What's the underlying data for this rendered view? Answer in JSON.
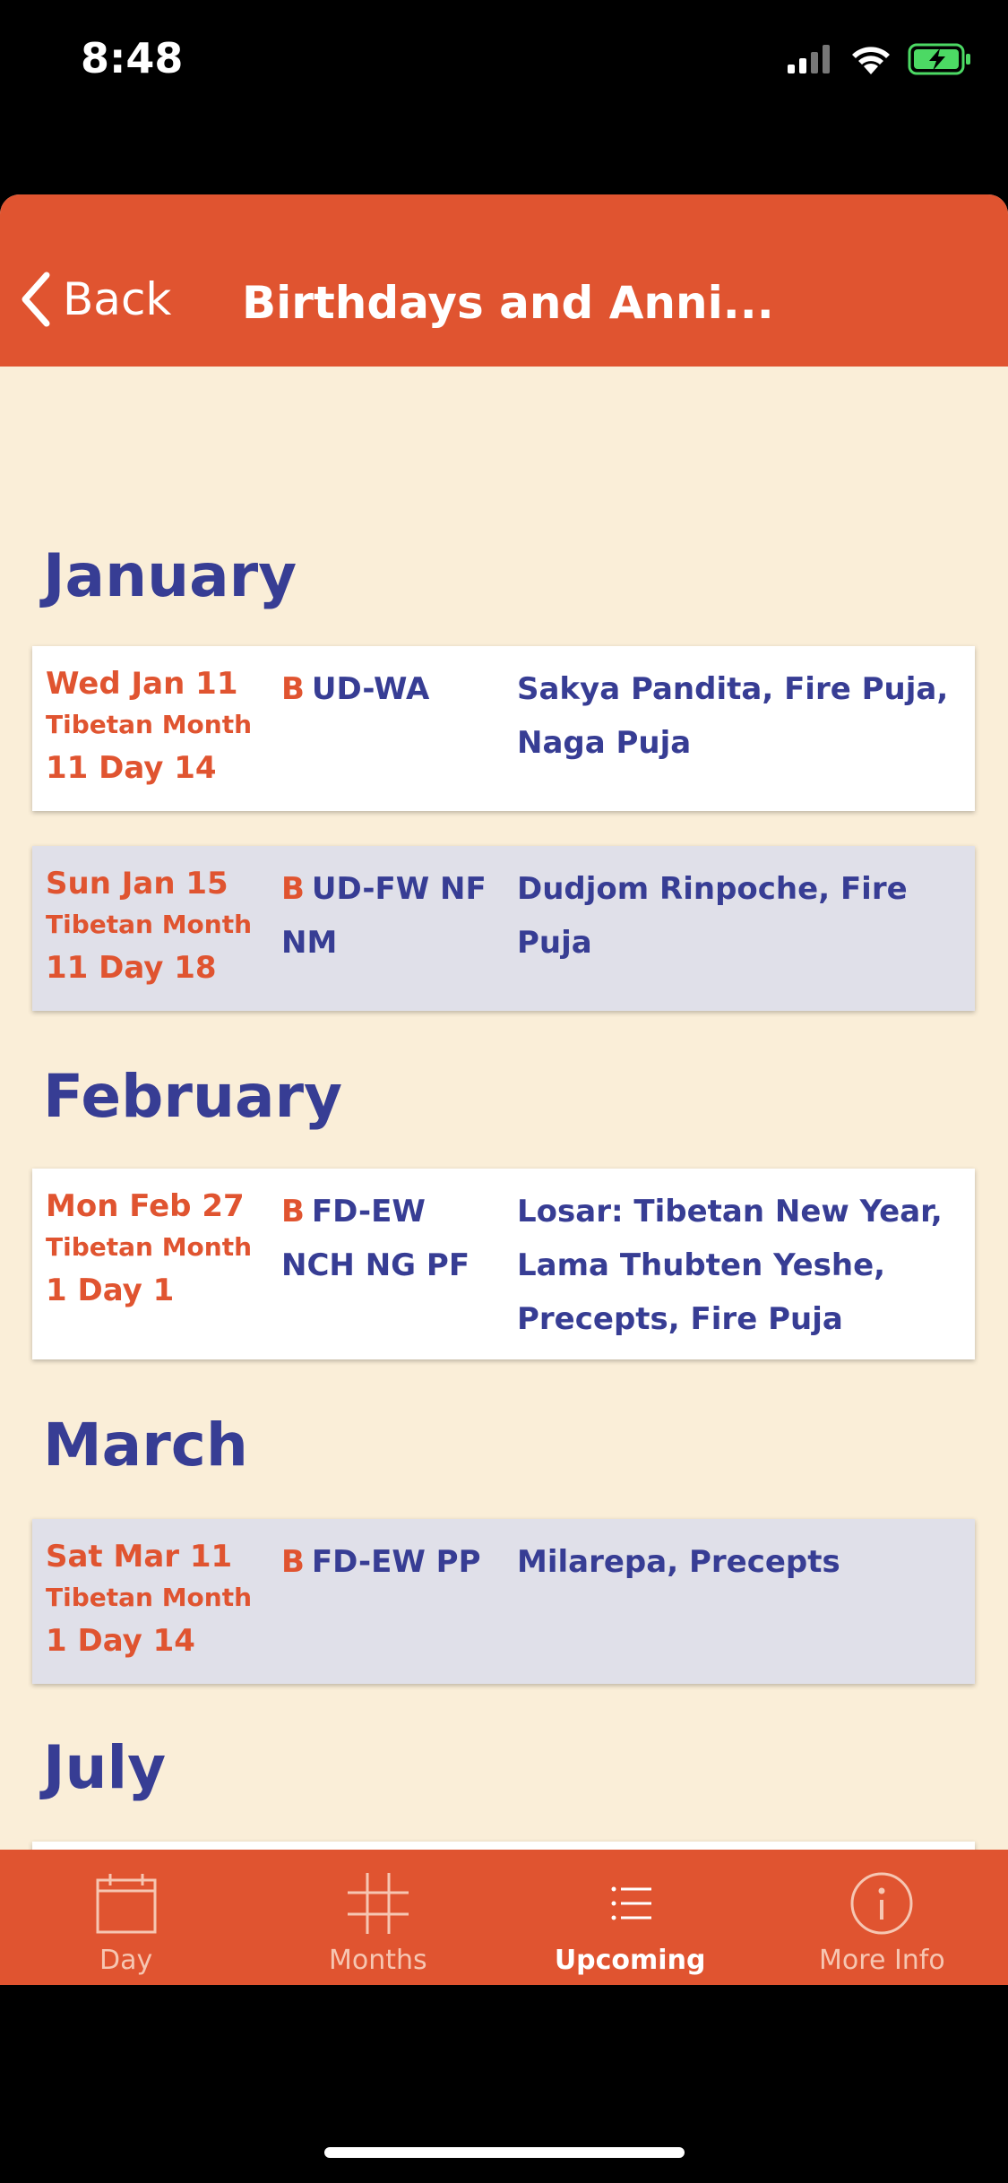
{
  "status_bar": {
    "time": "8:48"
  },
  "navbar": {
    "back_label": "Back",
    "title": "Birthdays and Anni..."
  },
  "sections": [
    {
      "month": "January"
    },
    {
      "month": "February"
    },
    {
      "month": "March"
    },
    {
      "month": "July"
    }
  ],
  "entries": [
    {
      "date": "Wed Jan 11",
      "tibetan_label": "Tibetan Month",
      "tibetan_day": "11 Day 14",
      "code_prefix": "B",
      "code": "UD-WA",
      "events": "Sakya Pandita, Fire Puja, Naga Puja"
    },
    {
      "date": "Sun Jan 15",
      "tibetan_label": "Tibetan Month",
      "tibetan_day": "11 Day 18",
      "code_prefix": "B",
      "code": "UD-FW NF NM",
      "events": "Dudjom Rinpoche, Fire Puja"
    },
    {
      "date": "Mon Feb 27",
      "tibetan_label": "Tibetan Month",
      "tibetan_day": "1 Day 1",
      "code_prefix": "B",
      "code": "FD-EW NCH NG PF",
      "events": "Losar: Tibetan New Year, Lama Thubten Yeshe, Precepts, Fire Puja"
    },
    {
      "date": "Sat Mar 11",
      "tibetan_label": "Tibetan Month",
      "tibetan_day": "1 Day 14",
      "code_prefix": "B",
      "code": "FD-EW PP",
      "events": "Milarepa, Precepts"
    }
  ],
  "tabbar": {
    "tabs": [
      {
        "label": "Day",
        "icon": "calendar-icon"
      },
      {
        "label": "Months",
        "icon": "grid-icon"
      },
      {
        "label": "Upcoming",
        "icon": "list-icon",
        "active": true
      },
      {
        "label": "More Info",
        "icon": "info-icon"
      }
    ]
  },
  "colors": {
    "accent": "#E05430",
    "text_blue": "#373D94",
    "background": "#FAEED8",
    "card_alt": "#E0E0E9"
  }
}
